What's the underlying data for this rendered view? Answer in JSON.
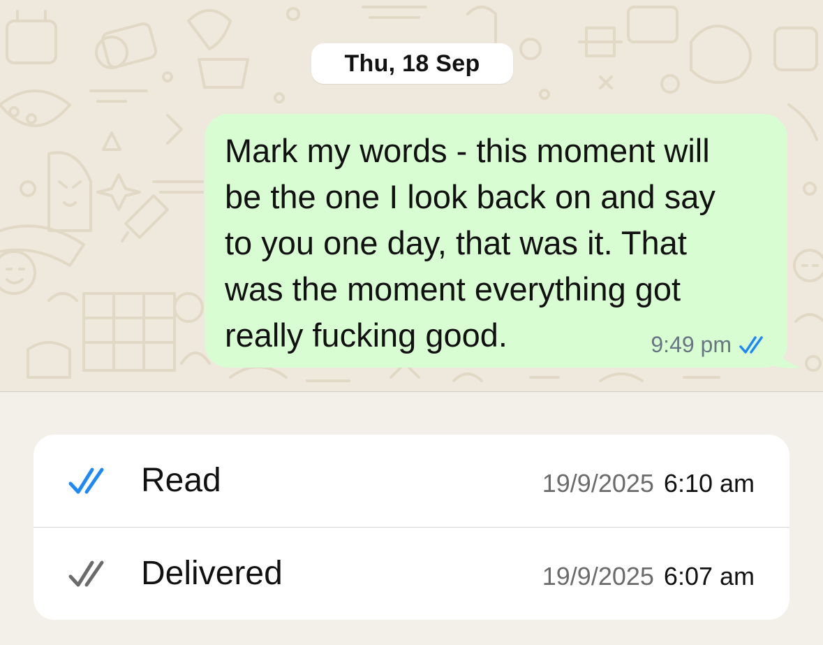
{
  "chat": {
    "date_separator": "Thu, 18 Sep",
    "message": {
      "text": "Mark my words - this moment will\nbe the one I look back on and say\nto you one day, that was it. That\nwas the moment everything got\nreally fucking good.",
      "time": "9:49 pm",
      "status_icon": "double-check-read-icon"
    }
  },
  "message_info": {
    "rows": [
      {
        "label": "Read",
        "icon": "double-check-read-icon",
        "date": "19/9/2025",
        "time": "6:10 am"
      },
      {
        "label": "Delivered",
        "icon": "double-check-delivered-icon",
        "date": "19/9/2025",
        "time": "6:07 am"
      }
    ]
  },
  "colors": {
    "outgoing_bubble": "#d9fdd3",
    "read_tick": "#1e88f5",
    "delivered_tick": "#6b6b6b",
    "chat_wallpaper": "#efe8dc",
    "info_background": "#f3f0ea"
  }
}
